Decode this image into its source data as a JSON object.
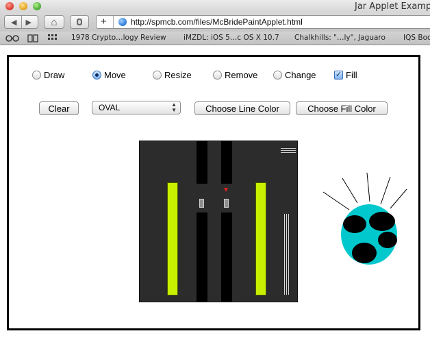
{
  "window": {
    "title": "Jar Applet Examp"
  },
  "toolbar": {
    "back_icon": "◀",
    "forward_icon": "▶",
    "home_icon": "⌂",
    "add_icon": "+",
    "url": "http://spmcb.com/files/McBridePaintApplet.html"
  },
  "bookmarks": {
    "items": [
      "1978 Crypto…logy Review",
      "iMZDL: iOS 5…c OS X 10.7",
      "Chalkhills: \"…ly\", Jaguaro",
      "IQS Boo"
    ]
  },
  "applet": {
    "modes": [
      {
        "label": "Draw",
        "selected": false
      },
      {
        "label": "Move",
        "selected": true
      },
      {
        "label": "Resize",
        "selected": false
      },
      {
        "label": "Remove",
        "selected": false
      },
      {
        "label": "Change",
        "selected": false
      }
    ],
    "fill": {
      "label": "Fill",
      "checked": true
    },
    "clear_label": "Clear",
    "shape_select": {
      "value": "OVAL"
    },
    "line_color_label": "Choose Line Color",
    "fill_color_label": "Choose Fill Color"
  },
  "colors": {
    "video_background": "#2c2c2c",
    "meter": "#c8f000",
    "oval_fill": "#00c8cc",
    "spots": "#000000",
    "marker": "#e02020"
  }
}
